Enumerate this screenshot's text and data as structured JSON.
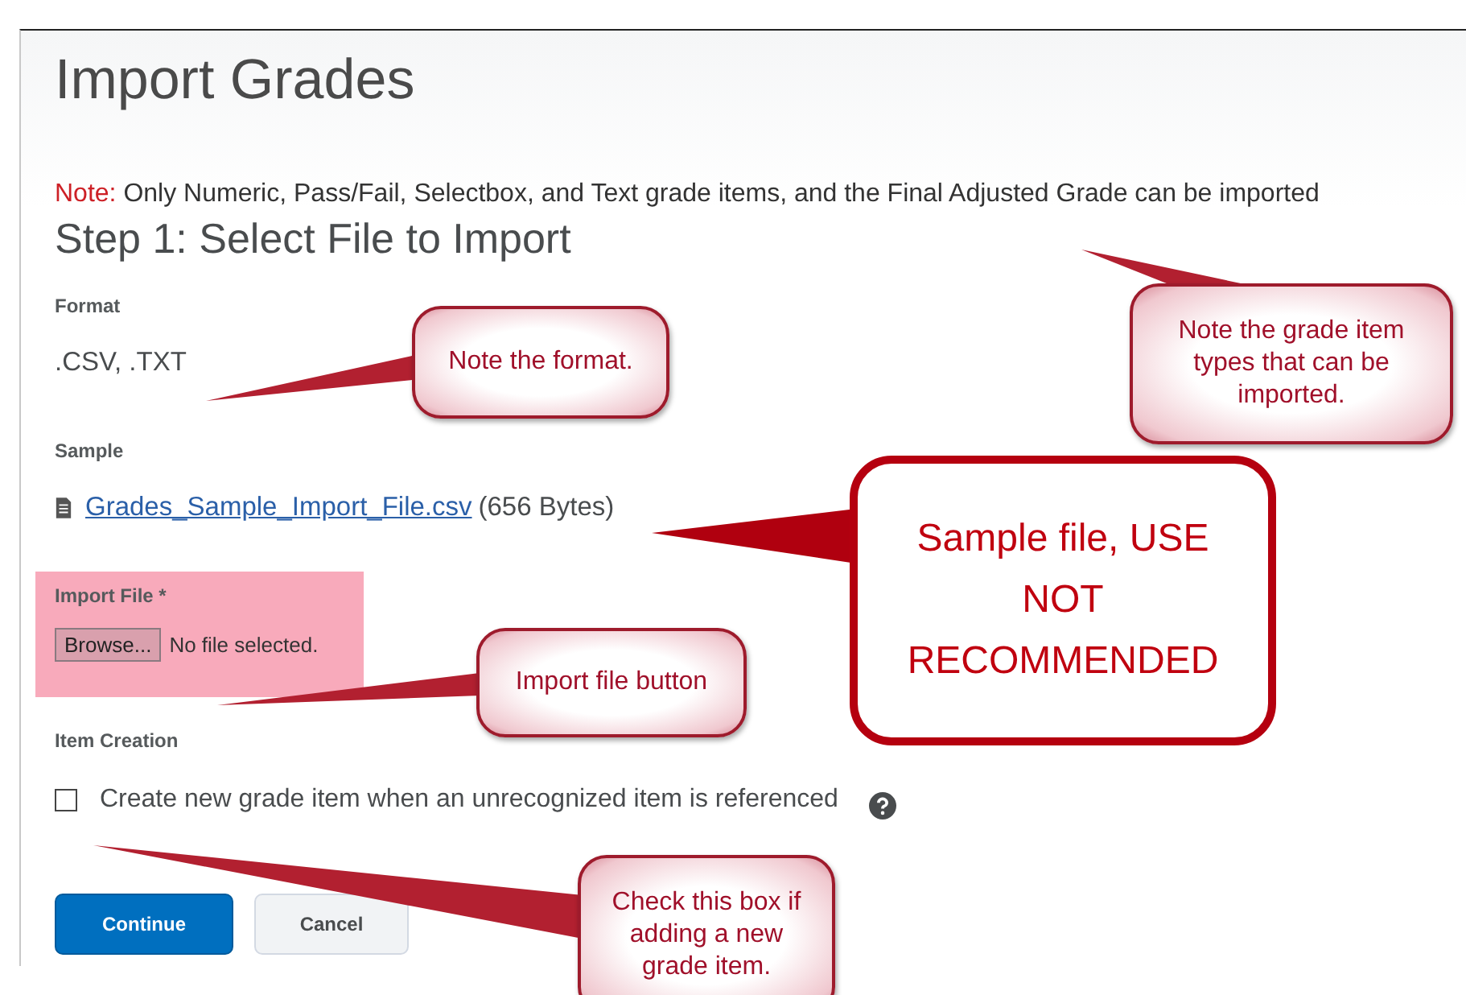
{
  "page": {
    "title": "Import Grades"
  },
  "note": {
    "label": "Note:",
    "text": "Only Numeric, Pass/Fail, Selectbox, and Text grade items, and the Final Adjusted Grade can be imported"
  },
  "step_heading": "Step 1: Select File to Import",
  "format": {
    "label": "Format",
    "value": ".CSV, .TXT"
  },
  "sample": {
    "label": "Sample",
    "link": "Grades_Sample_Import_File.csv",
    "size": "(656 Bytes)"
  },
  "import_file": {
    "label": "Import File *",
    "button": "Browse...",
    "status": "No file selected.",
    "highlighted": true
  },
  "item_creation": {
    "label": "Item Creation",
    "checkbox": {
      "label": "Create new grade item when an unrecognized item is referenced",
      "checked": false
    }
  },
  "buttons": [
    {
      "label": "Continue",
      "kind": "primary"
    },
    {
      "label": "Cancel",
      "kind": "secondary"
    }
  ],
  "callouts": [
    {
      "text": "Note the format.",
      "kind": "soft"
    },
    {
      "text": "Note the grade item types that can be imported.",
      "kind": "soft"
    },
    {
      "text": "Sample file, USE NOT RECOMMENDED",
      "kind": "bold"
    },
    {
      "text": "Import file button",
      "kind": "soft"
    },
    {
      "text": "Check this box if adding a new grade item.",
      "kind": "soft"
    }
  ]
}
